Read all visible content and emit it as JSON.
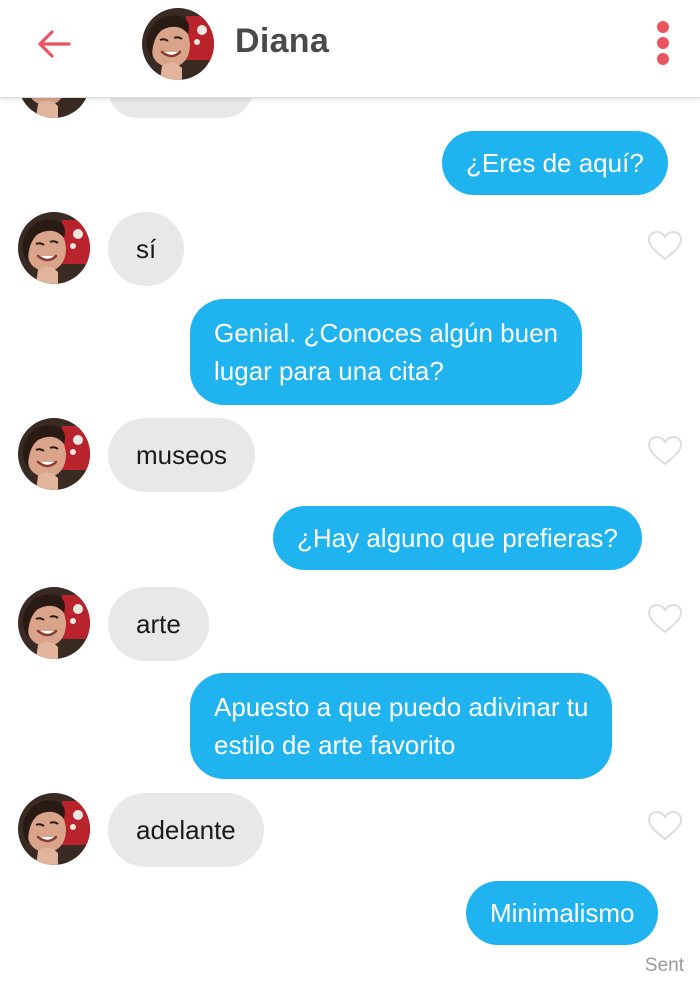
{
  "header": {
    "contact_name": "Diana"
  },
  "messages": [
    {
      "direction": "received",
      "text": "",
      "partial": true
    },
    {
      "direction": "sent",
      "text": "¿Eres de aquí?"
    },
    {
      "direction": "received",
      "text": "sí"
    },
    {
      "direction": "sent",
      "lines": [
        "Genial. ¿Conoces algún buen",
        "lugar para una cita?"
      ]
    },
    {
      "direction": "received",
      "text": "museos"
    },
    {
      "direction": "sent",
      "text": "¿Hay alguno que prefieras?"
    },
    {
      "direction": "received",
      "text": "arte"
    },
    {
      "direction": "sent",
      "lines": [
        "Apuesto a que puedo adivinar tu",
        "estilo de arte favorito"
      ]
    },
    {
      "direction": "received",
      "text": "adelante"
    },
    {
      "direction": "sent",
      "text": "Minimalismo"
    }
  ],
  "status": {
    "sent_label": "Sent"
  },
  "colors": {
    "accent": "#e95460",
    "sent_bubble": "#1fb3f0",
    "received_bubble": "#e8e8e8",
    "heart_outline": "#dddddd"
  },
  "icons": {
    "back": "arrow-left-icon",
    "menu": "kebab-menu-icon",
    "like": "heart-outline-icon"
  }
}
